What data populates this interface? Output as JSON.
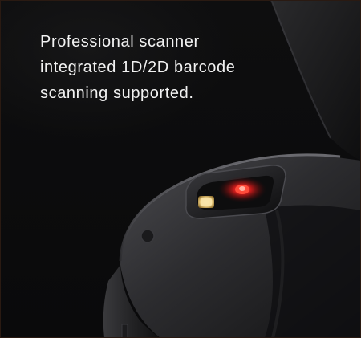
{
  "caption": {
    "lines": [
      "Professional scanner",
      "integrated 1D/2D barcode",
      "scanning supported."
    ]
  },
  "colors": {
    "background": "#0b0b0c",
    "body": "#2b2b2e",
    "laser": "#ff2a2a",
    "led": "#f2d489",
    "text": "#f2f2f2"
  },
  "icons": {
    "scanner_window": "scanner-window-icon",
    "laser": "laser-light-icon",
    "led": "flash-led-icon"
  }
}
